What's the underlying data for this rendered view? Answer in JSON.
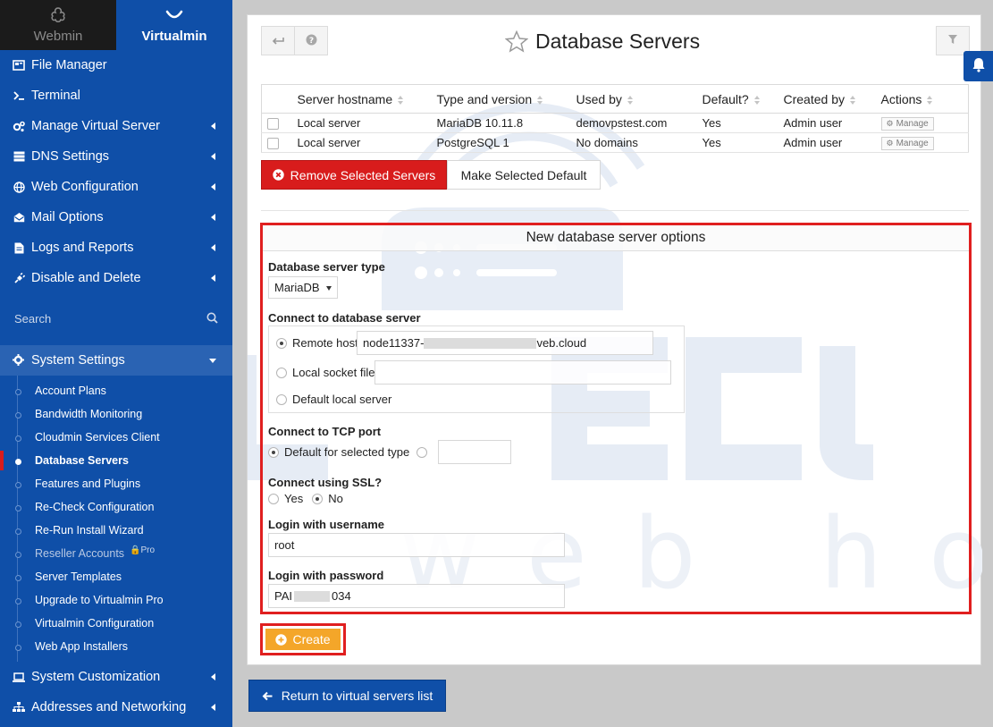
{
  "sidebar": {
    "brand": {
      "webmin": "Webmin",
      "virtualmin": "Virtualmin"
    },
    "items": [
      {
        "label": "File Manager",
        "icon": "folder-icon",
        "caret": false
      },
      {
        "label": "Terminal",
        "icon": "terminal-icon",
        "caret": false
      },
      {
        "label": "Manage Virtual Server",
        "icon": "gears-icon",
        "caret": true
      },
      {
        "label": "DNS Settings",
        "icon": "server-icon",
        "caret": true
      },
      {
        "label": "Web Configuration",
        "icon": "globe-icon",
        "caret": true
      },
      {
        "label": "Mail Options",
        "icon": "envelope-open-icon",
        "caret": true
      },
      {
        "label": "Logs and Reports",
        "icon": "file-text-icon",
        "caret": true
      },
      {
        "label": "Disable and Delete",
        "icon": "plug-icon",
        "caret": true
      }
    ],
    "search_placeholder": "Search",
    "system_settings": {
      "label": "System Settings",
      "items": [
        {
          "label": "Account Plans"
        },
        {
          "label": "Bandwidth Monitoring"
        },
        {
          "label": "Cloudmin Services Client"
        },
        {
          "label": "Database Servers",
          "active": true
        },
        {
          "label": "Features and Plugins"
        },
        {
          "label": "Re-Check Configuration"
        },
        {
          "label": "Re-Run Install Wizard"
        },
        {
          "label": "Reseller Accounts",
          "pro": "Pro"
        },
        {
          "label": "Server Templates"
        },
        {
          "label": "Upgrade to Virtualmin Pro"
        },
        {
          "label": "Virtualmin Configuration"
        },
        {
          "label": "Web App Installers"
        }
      ]
    },
    "after_items": [
      {
        "label": "System Customization",
        "icon": "laptop-icon"
      },
      {
        "label": "Addresses and Networking",
        "icon": "sitemap-icon"
      }
    ]
  },
  "page": {
    "title": "Database Servers"
  },
  "table": {
    "columns": [
      "Server hostname",
      "Type and version",
      "Used by",
      "Default?",
      "Created by",
      "Actions"
    ],
    "rows": [
      {
        "hostname": "Local server",
        "type": "MariaDB 10.11.8",
        "used_by": "demovpstest.com",
        "default": "Yes",
        "created_by": "Admin user",
        "action": "Manage"
      },
      {
        "hostname": "Local server",
        "type": "PostgreSQL 1",
        "used_by": "No domains",
        "default": "Yes",
        "created_by": "Admin user",
        "action": "Manage"
      }
    ]
  },
  "buttons": {
    "remove": "Remove Selected Servers",
    "make_default": "Make Selected Default",
    "create": "Create",
    "return": "Return to virtual servers list"
  },
  "options": {
    "heading": "New database server options",
    "server_type_label": "Database server type",
    "server_type_value": "MariaDB",
    "connect_label": "Connect to database server",
    "remote_host_label": "Remote host",
    "remote_host_prefix": "node11337-",
    "remote_host_suffix": "veb.cloud",
    "local_socket_label": "Local socket file",
    "default_local_label": "Default local server",
    "tcp_label": "Connect to TCP port",
    "tcp_default_label": "Default for selected type",
    "ssl_label": "Connect using SSL?",
    "ssl_yes": "Yes",
    "ssl_no": "No",
    "username_label": "Login with username",
    "username_value": "root",
    "password_label": "Login with password",
    "password_prefix": "PAI",
    "password_suffix": "034"
  },
  "colors": {
    "sidebar": "#0f4fa8",
    "danger": "#d81c1c",
    "warning": "#f4a629"
  }
}
